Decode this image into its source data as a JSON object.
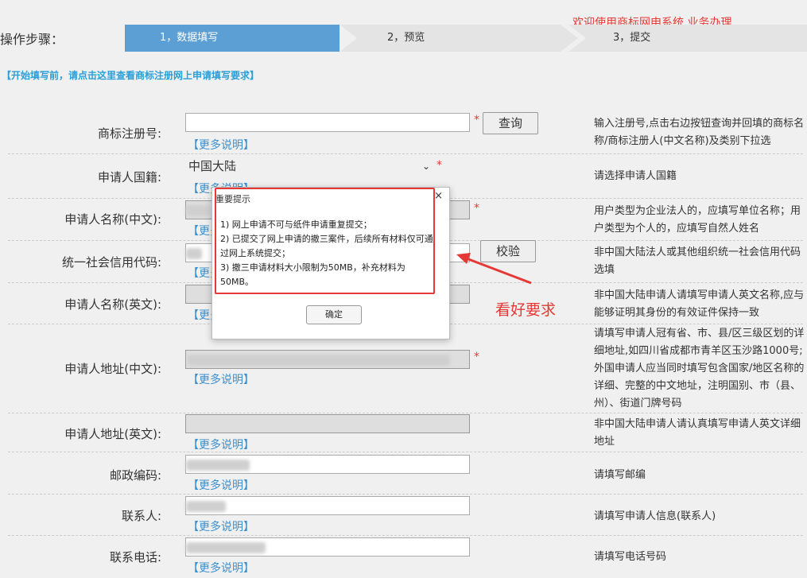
{
  "steps": {
    "label": "操作步骤：",
    "items": [
      "1，数据填写",
      "2，预览",
      "3，提交"
    ]
  },
  "notice": "欢迎使用商标网申系统 业务办理",
  "tip_link": "【开始填写前，请点击这里查看商标注册网上申请填写要求】",
  "more_label": "【更多说明】",
  "form": {
    "reg_no": {
      "label": "商标注册号:",
      "value": "",
      "button": "查询",
      "hint": "输入注册号,点击右边按钮查询并回填的商标名称/商标注册人(中文名称)及类别下拉选"
    },
    "nationality": {
      "label": "申请人国籍:",
      "value": "中国大陆",
      "hint": "请选择申请人国籍"
    },
    "name_cn": {
      "label": "申请人名称(中文):",
      "hint": "用户类型为企业法人的，应填写单位名称；用户类型为个人的，应填写自然人姓名"
    },
    "credit_code": {
      "label": "统一社会信用代码:",
      "button": "校验",
      "hint": "非中国大陆法人或其他组织统一社会信用代码选填"
    },
    "name_en": {
      "label": "申请人名称(英文):",
      "hint": "非中国大陆申请人请填写申请人英文名称,应与能够证明其身份的有效证件保持一致"
    },
    "addr_cn": {
      "label": "申请人地址(中文):",
      "hint": "请填写申请人冠有省、市、县/区三级区划的详细地址,如四川省成都市青羊区玉沙路1000号;外国申请人应当同时填写包含国家/地区名称的详细、完整的中文地址，注明国别、市（县、州）、街道门牌号码"
    },
    "addr_en": {
      "label": "申请人地址(英文):",
      "hint": "非中国大陆申请人请认真填写申请人英文详细地址"
    },
    "postcode": {
      "label": "邮政编码:",
      "hint": "请填写邮编"
    },
    "contact": {
      "label": "联系人:",
      "hint": "请填写申请人信息(联系人)"
    },
    "phone": {
      "label": "联系电话:",
      "hint": "请填写电话号码"
    }
  },
  "modal": {
    "title": "重要提示",
    "close": "×",
    "line1": "1) 网上申请不可与纸件申请重复提交；",
    "line2": "2) 已提交了网上申请的撤三案件，后续所有材料仅可通过网上系统提交；",
    "line3": "3) 撤三申请材料大小限制为50MB，补充材料为50MB。",
    "ok": "确定"
  },
  "annotation": "看好要求",
  "colors": {
    "step_active": "#5b9fd4",
    "accent_red": "#e53935",
    "link_blue": "#3a8fd0"
  }
}
